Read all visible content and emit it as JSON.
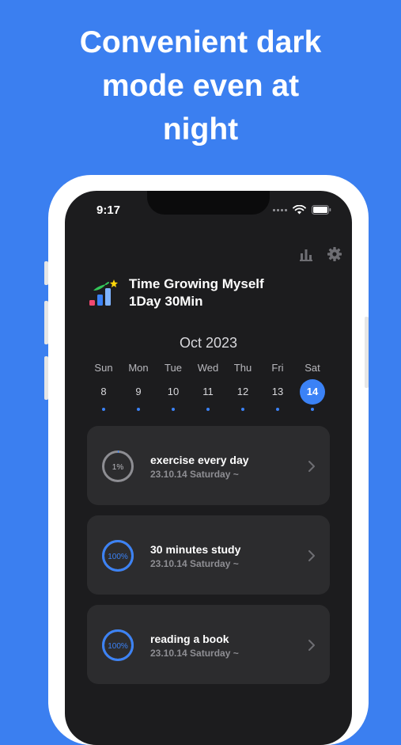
{
  "headline": [
    "Convenient dark",
    "mode even at",
    "night"
  ],
  "status_bar": {
    "time": "9:17"
  },
  "toolbar": {
    "stats_icon": "bar-chart-icon",
    "settings_icon": "gear-icon"
  },
  "header": {
    "line1": "Time Growing Myself",
    "line2": "1Day 30Min"
  },
  "calendar": {
    "month": "Oct 2023",
    "days": [
      {
        "weekday": "Sun",
        "date": "8"
      },
      {
        "weekday": "Mon",
        "date": "9"
      },
      {
        "weekday": "Tue",
        "date": "10"
      },
      {
        "weekday": "Wed",
        "date": "11"
      },
      {
        "weekday": "Thu",
        "date": "12"
      },
      {
        "weekday": "Fri",
        "date": "13"
      },
      {
        "weekday": "Sat",
        "date": "14"
      }
    ],
    "selected_date": "14"
  },
  "goals": [
    {
      "title": "exercise every day",
      "subtitle": "23.10.14 Saturday ~",
      "progress_label": "1%",
      "progress": 0.01
    },
    {
      "title": "30 minutes study",
      "subtitle": "23.10.14 Saturday ~",
      "progress_label": "100%",
      "progress": 1.0
    },
    {
      "title": "reading a book",
      "subtitle": "23.10.14 Saturday ~",
      "progress_label": "100%",
      "progress": 1.0
    }
  ],
  "colors": {
    "background": "#3b7ff0",
    "screen": "#1c1c1e",
    "card": "#2c2c2e",
    "accent": "#3b82f6",
    "ring_track": "#8e8e93"
  }
}
